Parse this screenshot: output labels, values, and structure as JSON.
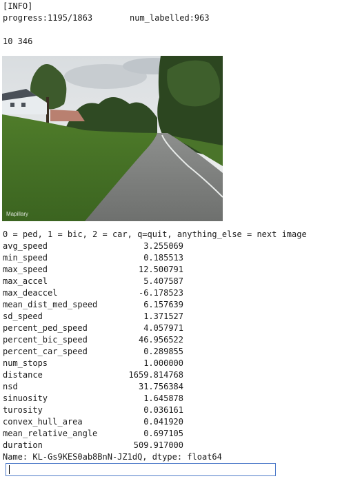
{
  "header": {
    "tag": "[INFO]",
    "progress": "progress:1195/1863",
    "num_labelled": "num_labelled:963",
    "dims": "10 346"
  },
  "image": {
    "watermark": "Mapillary"
  },
  "prompt": "0 = ped, 1 = bic, 2 = car, q=quit, anything_else = next image",
  "stats": [
    {
      "name": "avg_speed",
      "value": "3.255069"
    },
    {
      "name": "min_speed",
      "value": "0.185513"
    },
    {
      "name": "max_speed",
      "value": "12.500791"
    },
    {
      "name": "max_accel",
      "value": "5.407587"
    },
    {
      "name": "max_deaccel",
      "value": "-6.178523"
    },
    {
      "name": "mean_dist_med_speed",
      "value": "6.157639"
    },
    {
      "name": "sd_speed",
      "value": "1.371527"
    },
    {
      "name": "percent_ped_speed",
      "value": "4.057971"
    },
    {
      "name": "percent_bic_speed",
      "value": "46.956522"
    },
    {
      "name": "percent_car_speed",
      "value": "0.289855"
    },
    {
      "name": "num_stops",
      "value": "1.000000"
    },
    {
      "name": "distance",
      "value": "1659.814768"
    },
    {
      "name": "nsd",
      "value": "31.756384"
    },
    {
      "name": "sinuosity",
      "value": "1.645878"
    },
    {
      "name": "turosity",
      "value": "0.036161"
    },
    {
      "name": "convex_hull_area",
      "value": "0.041920"
    },
    {
      "name": "mean_relative_angle",
      "value": "0.697105"
    },
    {
      "name": "duration",
      "value": "509.917000"
    }
  ],
  "footer": "Name: KL-Gs9KES0ab8BnN-JZ1dQ, dtype: float64",
  "input": {
    "value": ""
  }
}
